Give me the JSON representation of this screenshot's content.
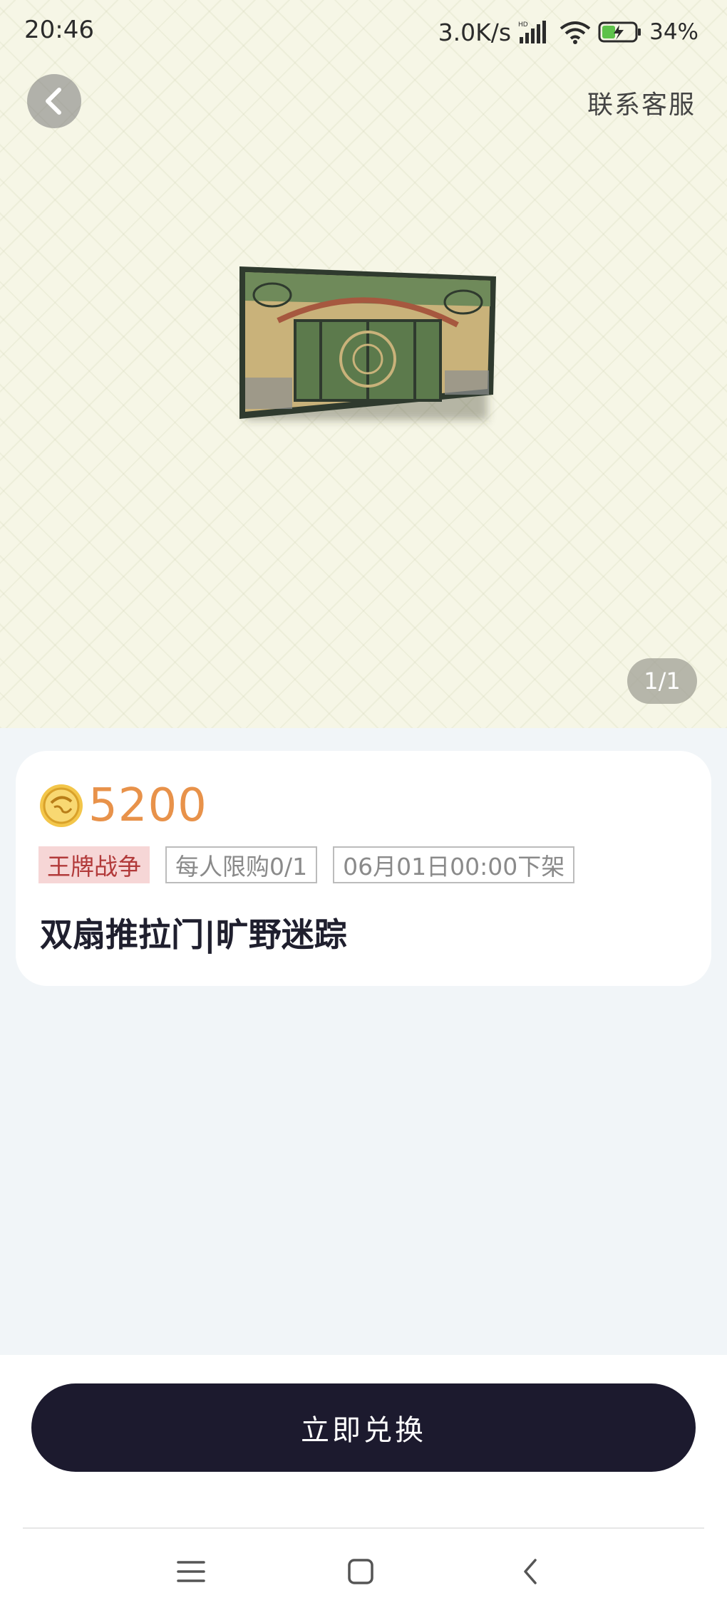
{
  "status_bar": {
    "time": "20:46",
    "network_speed": "3.0K/s",
    "network_badge": "HD",
    "battery_percent": "34%",
    "icons": [
      "signal-icon",
      "wifi-icon",
      "battery-charging-icon"
    ]
  },
  "header": {
    "back_icon": "chevron-left-icon",
    "service_label": "联系客服"
  },
  "gallery": {
    "page_indicator": "1/1"
  },
  "product": {
    "coin_icon": "coin-icon",
    "price": "5200",
    "tags": {
      "game": "王牌战争",
      "limit": "每人限购0/1",
      "offline_time": "06月01日00:00下架"
    },
    "title": "双扇推拉门|旷野迷踪"
  },
  "action": {
    "redeem_label": "立即兑换"
  },
  "nav_bar": {
    "icons": [
      "menu-icon",
      "home-icon",
      "back-icon"
    ]
  },
  "colors": {
    "price": "#e8924a",
    "button_bg": "#1c1a2e",
    "tag_game_bg": "#f6d6d6",
    "tag_game_text": "#b23a3a",
    "page_bg": "#f1f5f8"
  }
}
